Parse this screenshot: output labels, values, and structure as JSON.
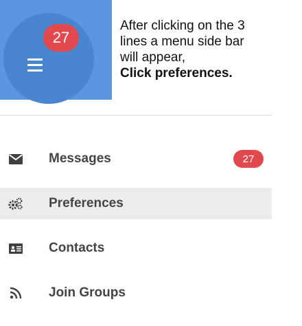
{
  "panel": {
    "notification_count": "27",
    "menu_icon": "hamburger-icon",
    "accent_color": "#5b97e0",
    "badge_color": "#e2494d"
  },
  "instructions": {
    "line1": "After clicking on the 3",
    "line2": "lines a menu side bar",
    "line3": "will appear,",
    "emphasis": "Click preferences."
  },
  "sidebar": {
    "items": [
      {
        "label": "Messages",
        "icon": "envelope-icon",
        "badge": "27"
      },
      {
        "label": "Preferences",
        "icon": "gears-icon",
        "highlighted": true
      },
      {
        "label": "Contacts",
        "icon": "contact-card-icon"
      },
      {
        "label": "Join Groups",
        "icon": "rss-icon"
      }
    ]
  }
}
